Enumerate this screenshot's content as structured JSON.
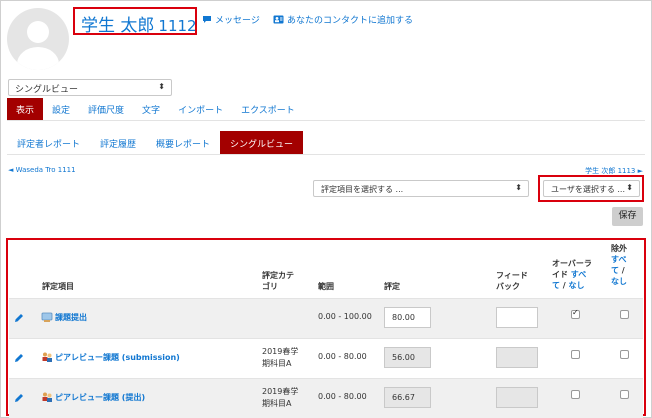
{
  "colors": {
    "link": "#1177d1",
    "active_tab": "#a30000",
    "highlight_box": "#d9000d"
  },
  "user": {
    "name": "学生 太郎",
    "number": "1112"
  },
  "header_links": {
    "message": "メッセージ",
    "add_contact": "あなたのコンタクトに追加する"
  },
  "view_select": {
    "value": "シングルビュー"
  },
  "main_tabs": [
    {
      "label": "表示",
      "active": true
    },
    {
      "label": "設定",
      "active": false
    },
    {
      "label": "評価尺度",
      "active": false
    },
    {
      "label": "文字",
      "active": false
    },
    {
      "label": "インポート",
      "active": false
    },
    {
      "label": "エクスポート",
      "active": false
    }
  ],
  "report_tabs": [
    {
      "label": "評定者レポート",
      "active": false
    },
    {
      "label": "評定履歴",
      "active": false
    },
    {
      "label": "概要レポート",
      "active": false
    },
    {
      "label": "シングルビュー",
      "active": true
    }
  ],
  "nav": {
    "prev_user": "◄ Waseda Tro 1111",
    "next_user": "学生 次郎 1113 ►"
  },
  "selectors": {
    "grade_item": "評定項目を選択する ...",
    "user": "ユーザを選択する ..."
  },
  "save_label": "保存",
  "table": {
    "headers": {
      "item": "評定項目",
      "category_l1": "評定カテ",
      "category_l2": "ゴリ",
      "range": "範囲",
      "grade": "評定",
      "feedback_l1": "フィード",
      "feedback_l2": "バック",
      "override_l1": "オーバーラ",
      "override_l2a": "イド",
      "override_all_a": "すべ",
      "override_all_b": "て",
      "override_sep": " / ",
      "override_none": "なし",
      "exclude": "除外",
      "exclude_all_a": "すべ",
      "exclude_all_b": "て",
      "exclude_sep": " /",
      "exclude_none": "なし"
    },
    "rows": [
      {
        "name": "課題提出",
        "cat_l1": "",
        "cat_l2": "",
        "range": "0.00 - 100.00",
        "grade": "80.00",
        "grade_readonly": false,
        "override": true,
        "exclude": false
      },
      {
        "name": "ピアレビュー課題 (submission)",
        "cat_l1": "2019春学",
        "cat_l2": "期科目A",
        "range": "0.00 - 80.00",
        "grade": "56.00",
        "grade_readonly": true,
        "override": false,
        "exclude": false
      },
      {
        "name": "ピアレビュー課題 (提出)",
        "cat_l1": "2019春学",
        "cat_l2": "期科目A",
        "range": "0.00 - 80.00",
        "grade": "66.67",
        "grade_readonly": true,
        "override": false,
        "exclude": false
      }
    ]
  }
}
